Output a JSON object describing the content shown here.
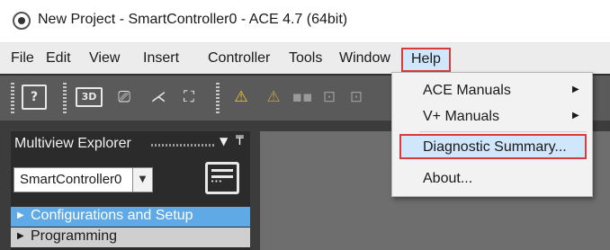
{
  "window": {
    "title": "New Project - SmartController0 - ACE 4.7 (64bit)"
  },
  "menubar": {
    "items": [
      "File",
      "Edit",
      "View",
      "Insert",
      "Controller",
      "Tools",
      "Window",
      "Help"
    ]
  },
  "help_menu": {
    "items": [
      {
        "label": "ACE Manuals",
        "has_submenu": true
      },
      {
        "label": "V+ Manuals",
        "has_submenu": true
      },
      {
        "label": "Diagnostic Summary...",
        "has_submenu": false,
        "highlighted": true
      },
      {
        "label": "About...",
        "has_submenu": false
      }
    ]
  },
  "toolbar": {
    "icons": [
      "help-icon",
      "3d-view-icon",
      "device-icon",
      "tool-icon",
      "network-icon",
      "warning-icon",
      "disabled-warning-icon",
      "grid-icon",
      "io-icon",
      "io-alt-icon"
    ],
    "labels": {
      "help": "?",
      "view3d": "3D"
    }
  },
  "explorer": {
    "title": "Multiview Explorer",
    "controller": "SmartController0",
    "tree": [
      {
        "label": "Configurations and Setup",
        "selected": true
      },
      {
        "label": "Programming",
        "selected": false
      }
    ]
  },
  "colors": {
    "highlight_border": "#d93a3a",
    "menu_highlight": "#cfe6fb",
    "tree_selected": "#5fa9e6",
    "warning_yellow": "#f2c230"
  }
}
